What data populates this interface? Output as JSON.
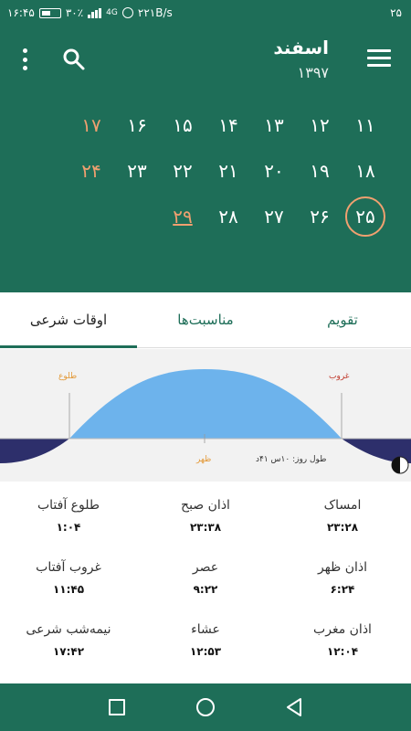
{
  "status_bar": {
    "time": "۱۶:۴۵",
    "battery": "۳۰٪",
    "signal": "4G",
    "data_speed": "۲۲۱B/s",
    "date": "۲۵"
  },
  "header": {
    "month": "اسفند",
    "year": "۱۳۹۷",
    "menu_icon": "hamburger-menu-icon",
    "search_icon": "search-icon",
    "more_icon": "more-vertical-icon",
    "colors": {
      "primary": "#1e6e58",
      "holiday": "#f0a070"
    }
  },
  "calendar": {
    "weeks": [
      [
        {
          "day": "۱۱"
        },
        {
          "day": "۱۲"
        },
        {
          "day": "۱۳"
        },
        {
          "day": "۱۴"
        },
        {
          "day": "۱۵"
        },
        {
          "day": "۱۶"
        },
        {
          "day": "۱۷",
          "holiday": true
        }
      ],
      [
        {
          "day": "۱۸"
        },
        {
          "day": "۱۹"
        },
        {
          "day": "۲۰"
        },
        {
          "day": "۲۱"
        },
        {
          "day": "۲۲"
        },
        {
          "day": "۲۳"
        },
        {
          "day": "۲۴",
          "holiday": true
        }
      ],
      [
        {
          "day": "۲۵",
          "selected": true
        },
        {
          "day": "۲۶"
        },
        {
          "day": "۲۷"
        },
        {
          "day": "۲۸"
        },
        {
          "day": "۲۹",
          "holiday": true,
          "today": true
        }
      ]
    ]
  },
  "tabs": [
    {
      "label": "تقویم",
      "active": false
    },
    {
      "label": "مناسبت‌ها",
      "active": false
    },
    {
      "label": "اوقات شرعی",
      "active": true
    }
  ],
  "sun_chart": {
    "sunrise_label": "طلوع",
    "sunset_label": "غروب",
    "noon_label": "ظهر",
    "day_length_label": "طول روز: ۱۰س ۴۱د"
  },
  "times": [
    [
      {
        "name": "امساک",
        "value": "۲۳:۲۸"
      },
      {
        "name": "اذان صبح",
        "value": "۲۳:۳۸"
      },
      {
        "name": "طلوع آفتاب",
        "value": "۱:۰۴"
      }
    ],
    [
      {
        "name": "اذان ظهر",
        "value": "۶:۲۴"
      },
      {
        "name": "عصر",
        "value": "۹:۲۲"
      },
      {
        "name": "غروب آفتاب",
        "value": "۱۱:۴۵"
      }
    ],
    [
      {
        "name": "اذان مغرب",
        "value": "۱۲:۰۴"
      },
      {
        "name": "عشاء",
        "value": "۱۲:۵۳"
      },
      {
        "name": "نیمه‌شب شرعی",
        "value": "۱۷:۴۲"
      }
    ]
  ],
  "nav": {
    "recents_icon": "square-recents-icon",
    "home_icon": "circle-home-icon",
    "back_icon": "triangle-back-icon"
  }
}
